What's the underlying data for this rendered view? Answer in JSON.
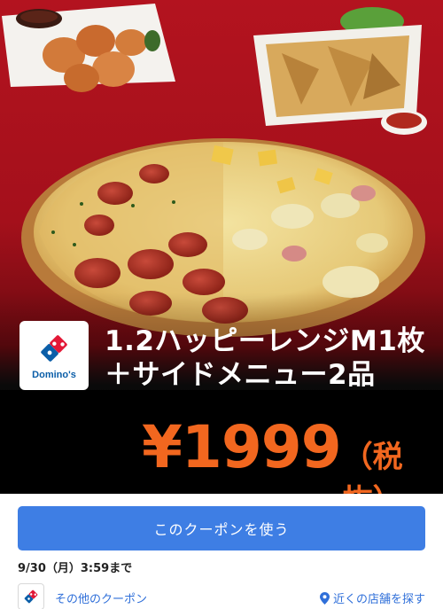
{
  "coupon": {
    "title_line1": "1.2ハッピーレンジM1枚",
    "title_line2": "＋サイドメニュー2品",
    "price": "¥1999",
    "price_suffix": "（税抜）",
    "brand_logo_text": "Domino's"
  },
  "actions": {
    "use_coupon_label": "このクーポンを使う"
  },
  "expiry": {
    "text": "9/30（月）3:59まで"
  },
  "footer": {
    "other_coupons_label": "その他のクーポン",
    "nearby_stores_label": "近くの店舗を探す",
    "pin_icon": "map-pin-icon"
  },
  "colors": {
    "hero_red": "#b3131f",
    "price_orange": "#f2671f",
    "button_blue": "#3e7ee4",
    "link_blue": "#2f6fd9",
    "brand_blue": "#0b5ea8",
    "brand_red": "#e31837"
  }
}
